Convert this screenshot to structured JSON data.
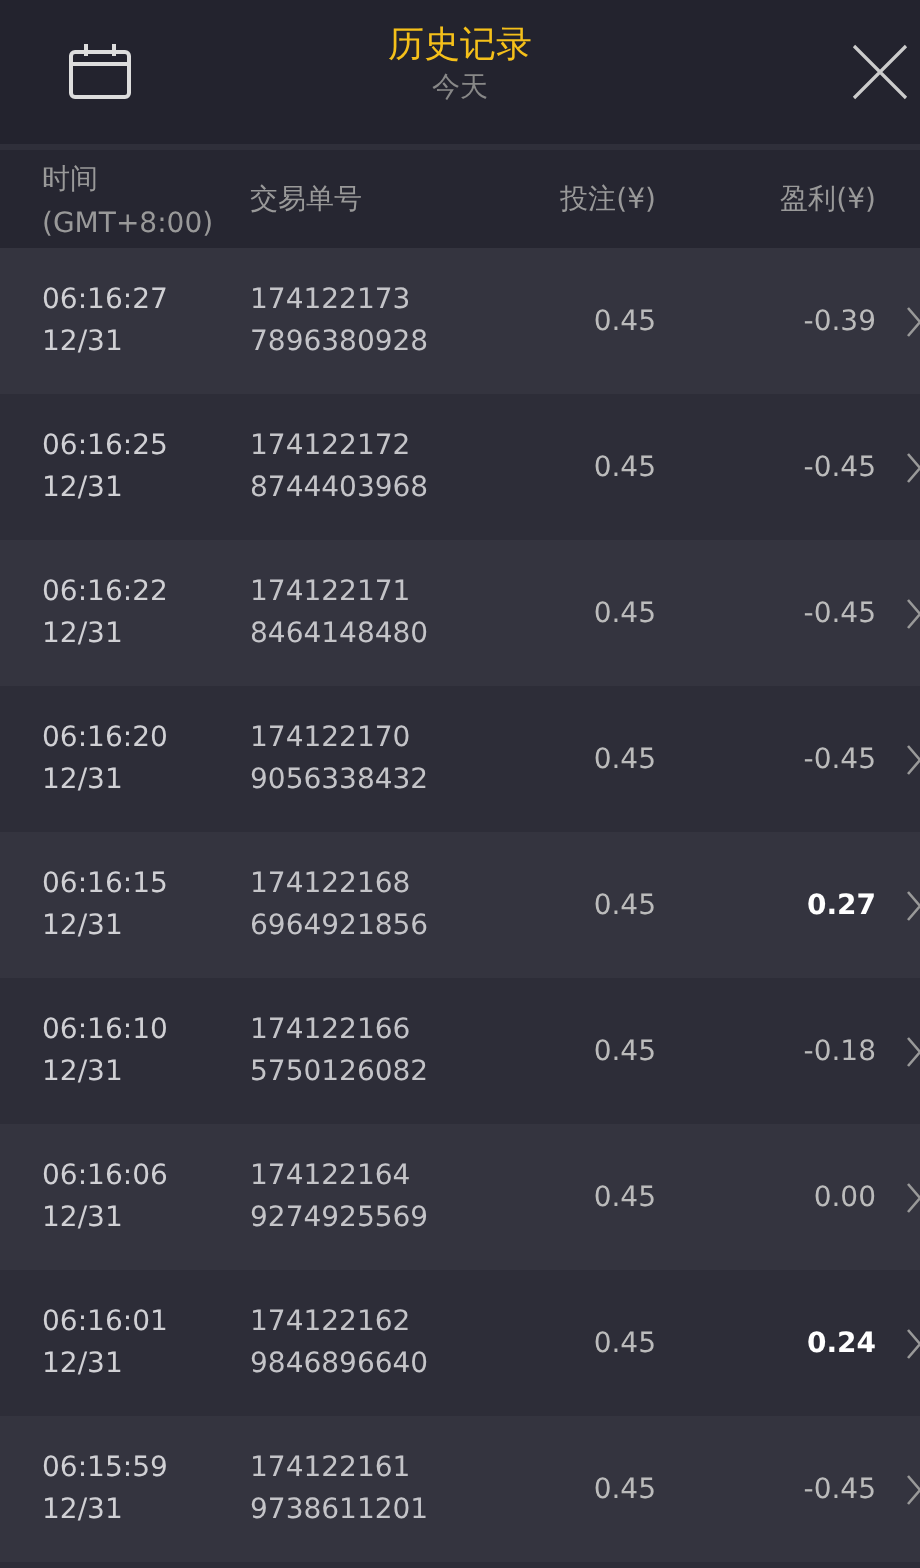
{
  "header": {
    "title": "历史记录",
    "subtitle": "今天"
  },
  "columns": {
    "time": [
      "时间",
      "(GMT+8:00)"
    ],
    "order": "交易单号",
    "bet": "投注(¥)",
    "profit": "盈利(¥)"
  },
  "rows": [
    {
      "time": "06:16:27",
      "date": "12/31",
      "order_1": "174122173",
      "order_2": "7896380928",
      "bet": "0.45",
      "profit": "-0.39",
      "positive": false
    },
    {
      "time": "06:16:25",
      "date": "12/31",
      "order_1": "174122172",
      "order_2": "8744403968",
      "bet": "0.45",
      "profit": "-0.45",
      "positive": false
    },
    {
      "time": "06:16:22",
      "date": "12/31",
      "order_1": "174122171",
      "order_2": "8464148480",
      "bet": "0.45",
      "profit": "-0.45",
      "positive": false
    },
    {
      "time": "06:16:20",
      "date": "12/31",
      "order_1": "174122170",
      "order_2": "9056338432",
      "bet": "0.45",
      "profit": "-0.45",
      "positive": false
    },
    {
      "time": "06:16:15",
      "date": "12/31",
      "order_1": "174122168",
      "order_2": "6964921856",
      "bet": "0.45",
      "profit": "0.27",
      "positive": true
    },
    {
      "time": "06:16:10",
      "date": "12/31",
      "order_1": "174122166",
      "order_2": "5750126082",
      "bet": "0.45",
      "profit": "-0.18",
      "positive": false
    },
    {
      "time": "06:16:06",
      "date": "12/31",
      "order_1": "174122164",
      "order_2": "9274925569",
      "bet": "0.45",
      "profit": "0.00",
      "positive": false
    },
    {
      "time": "06:16:01",
      "date": "12/31",
      "order_1": "174122162",
      "order_2": "9846896640",
      "bet": "0.45",
      "profit": "0.24",
      "positive": true
    },
    {
      "time": "06:15:59",
      "date": "12/31",
      "order_1": "174122161",
      "order_2": "9738611201",
      "bet": "0.45",
      "profit": "-0.45",
      "positive": false
    }
  ]
}
